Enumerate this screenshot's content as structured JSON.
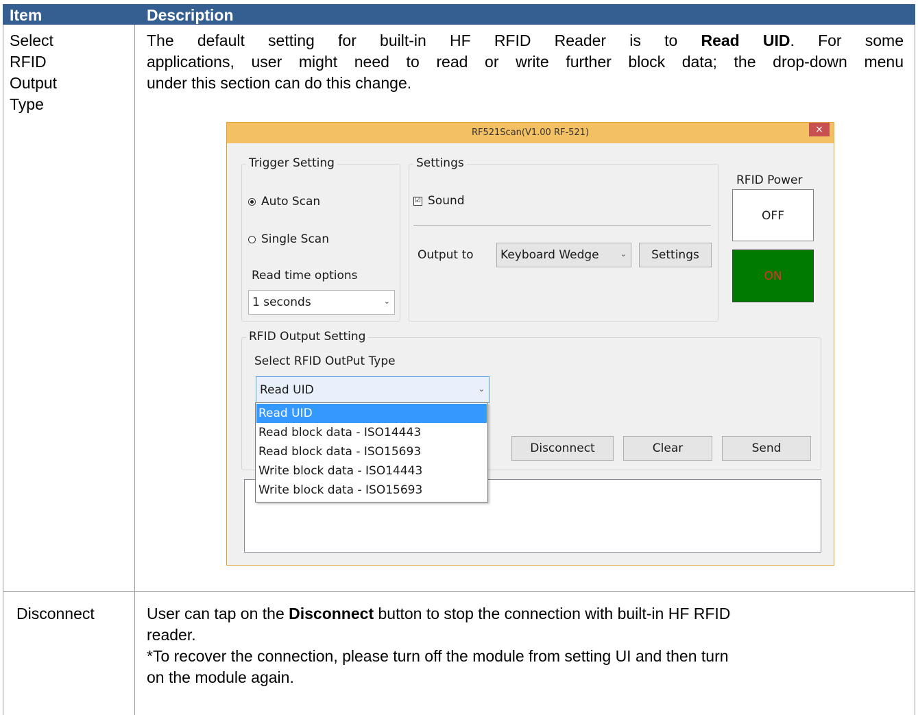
{
  "table": {
    "header": {
      "item": "Item",
      "description": "Description"
    },
    "row1": {
      "item_lines": [
        "Select",
        "RFID",
        "Output",
        "Type"
      ],
      "desc_line1_pre": "The default setting for built-in HF RFID Reader is to ",
      "desc_line1_bold": "Read UID",
      "desc_line1_post": ". For some",
      "desc_line2": "applications, user might need to read or write further block data; the drop-down menu",
      "desc_line3": "under this section can do this change."
    },
    "row2": {
      "item": "Disconnect",
      "desc_line1_pre": "User can tap on the ",
      "desc_line1_bold": "Disconnect",
      "desc_line1_post": " button to stop the connection with built-in HF RFID",
      "desc_line2": "reader.",
      "desc_line3": "*To recover the connection, please turn off the module from setting UI and then turn",
      "desc_line4": "on the module again."
    }
  },
  "window": {
    "title": "RF521Scan(V1.00 RF-521)",
    "close": "×",
    "trigger": {
      "label": "Trigger Setting",
      "auto_scan": "Auto Scan",
      "single_scan": "Single Scan",
      "read_time_label": "Read time options",
      "read_time_value": "1 seconds"
    },
    "settings": {
      "label": "Settings",
      "sound": "Sound",
      "output_to_label": "Output to",
      "output_to_value": "Keyboard Wedge",
      "settings_button": "Settings"
    },
    "power": {
      "label": "RFID Power",
      "off": "OFF",
      "on": "ON"
    },
    "rfid_output": {
      "label": "RFID Output Setting",
      "select_label": "Select RFID OutPut Type",
      "selected": "Read UID",
      "options": [
        "Read UID",
        "Read block data - ISO14443",
        "Read block data - ISO15693",
        "Write block data - ISO14443",
        "Write block data - ISO15693"
      ]
    },
    "buttons": {
      "disconnect": "Disconnect",
      "clear": "Clear",
      "send": "Send"
    },
    "icons": {
      "chevron": "chevron-down-icon",
      "check": "☑"
    },
    "colors": {
      "title_bar": "#f3c064",
      "close": "#c75050",
      "on_button": "#007a00",
      "selection": "#3399ff",
      "header": "#365f91"
    }
  }
}
